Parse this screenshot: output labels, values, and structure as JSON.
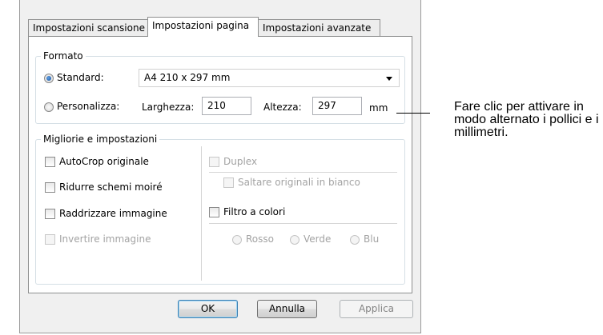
{
  "tabs": [
    {
      "label": "Impostazioni scansione"
    },
    {
      "label": "Impostazioni pagina"
    },
    {
      "label": "Impostazioni avanzate"
    }
  ],
  "formato": {
    "legend": "Formato",
    "standard_label": "Standard:",
    "standard_value": "A4 210 x 297 mm",
    "custom_label": "Personalizza:",
    "width_label": "Larghezza:",
    "width_value": "210",
    "height_label": "Altezza:",
    "height_value": "297",
    "unit": "mm"
  },
  "migliorie": {
    "legend": "Migliorie e impostazioni",
    "left": [
      {
        "label": "AutoCrop originale"
      },
      {
        "label": "Ridurre schemi moiré"
      },
      {
        "label": "Raddrizzare immagine"
      },
      {
        "label": "Invertire immagine"
      }
    ],
    "duplex_label": "Duplex",
    "skip_blank_label": "Saltare originali in bianco",
    "color_filter_label": "Filtro a colori",
    "colors": [
      {
        "label": "Rosso"
      },
      {
        "label": "Verde"
      },
      {
        "label": "Blu"
      }
    ]
  },
  "buttons": {
    "ok": "OK",
    "cancel": "Annulla",
    "apply": "Applica"
  },
  "callout": "Fare clic per attivare in modo alternato i pollici e i millimetri."
}
